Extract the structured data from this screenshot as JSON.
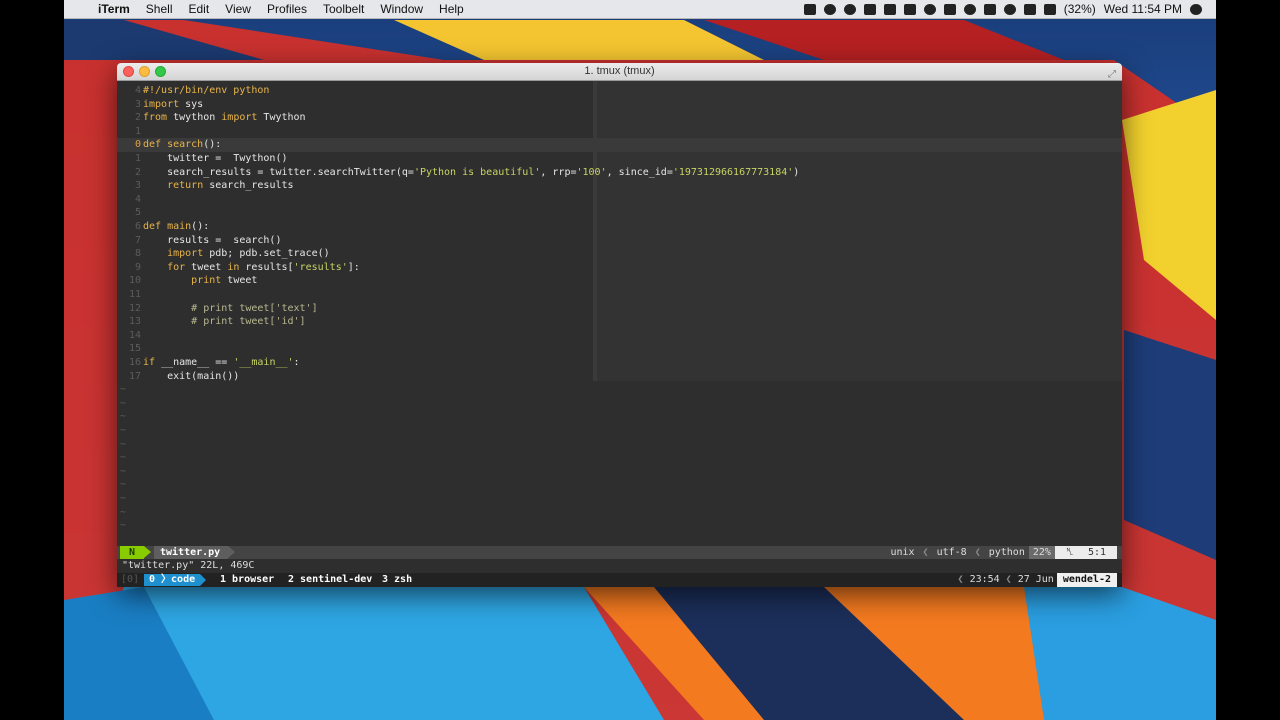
{
  "menubar": {
    "app_name": "iTerm",
    "items": [
      "Shell",
      "Edit",
      "View",
      "Profiles",
      "Toolbelt",
      "Window",
      "Help"
    ],
    "battery": "(32%)",
    "clock": "Wed 11:54 PM"
  },
  "window": {
    "title": "1. tmux (tmux)"
  },
  "editor": {
    "lines": [
      {
        "n": "4",
        "tokens": [
          {
            "t": "#!/usr/bin/env python",
            "c": "kw"
          }
        ]
      },
      {
        "n": "3",
        "tokens": [
          {
            "t": "import",
            "c": "kw"
          },
          {
            "t": " sys",
            "c": "pl"
          }
        ]
      },
      {
        "n": "2",
        "tokens": [
          {
            "t": "from",
            "c": "kw"
          },
          {
            "t": " twython ",
            "c": "pl"
          },
          {
            "t": "import",
            "c": "kw"
          },
          {
            "t": " Twython",
            "c": "pl"
          }
        ]
      },
      {
        "n": "1",
        "tokens": []
      },
      {
        "n": "0",
        "cur": true,
        "tokens": [
          {
            "t": "def",
            "c": "kw"
          },
          {
            "t": " search",
            "c": "sb"
          },
          {
            "t": "():",
            "c": "pl"
          }
        ]
      },
      {
        "n": "1",
        "tokens": [
          {
            "t": "    twitter =  Twython()",
            "c": "pl"
          }
        ]
      },
      {
        "n": "2",
        "tokens": [
          {
            "t": "    search_results = twitter.searchTwitter(q=",
            "c": "pl"
          },
          {
            "t": "'Python is beautiful'",
            "c": "str"
          },
          {
            "t": ", rrp=",
            "c": "pl"
          },
          {
            "t": "'100'",
            "c": "str"
          },
          {
            "t": ", since_id=",
            "c": "pl"
          },
          {
            "t": "'197312966167773184'",
            "c": "str"
          },
          {
            "t": ")",
            "c": "pl"
          }
        ]
      },
      {
        "n": "3",
        "tokens": [
          {
            "t": "    ",
            "c": "pl"
          },
          {
            "t": "return",
            "c": "kw"
          },
          {
            "t": " search_results",
            "c": "pl"
          }
        ]
      },
      {
        "n": "4",
        "tokens": []
      },
      {
        "n": "5",
        "tokens": []
      },
      {
        "n": "6",
        "tokens": [
          {
            "t": "def",
            "c": "kw"
          },
          {
            "t": " main",
            "c": "sb"
          },
          {
            "t": "():",
            "c": "pl"
          }
        ]
      },
      {
        "n": "7",
        "tokens": [
          {
            "t": "    results =  search()",
            "c": "pl"
          }
        ]
      },
      {
        "n": "8",
        "tokens": [
          {
            "t": "    ",
            "c": "pl"
          },
          {
            "t": "import",
            "c": "kw"
          },
          {
            "t": " pdb; pdb.set_trace()",
            "c": "pl"
          }
        ]
      },
      {
        "n": "9",
        "tokens": [
          {
            "t": "    ",
            "c": "pl"
          },
          {
            "t": "for",
            "c": "kw"
          },
          {
            "t": " tweet ",
            "c": "pl"
          },
          {
            "t": "in",
            "c": "kw"
          },
          {
            "t": " results[",
            "c": "pl"
          },
          {
            "t": "'results'",
            "c": "str"
          },
          {
            "t": "]:",
            "c": "pl"
          }
        ]
      },
      {
        "n": "10",
        "tokens": [
          {
            "t": "        ",
            "c": "pl"
          },
          {
            "t": "print",
            "c": "kw"
          },
          {
            "t": " tweet",
            "c": "pl"
          }
        ]
      },
      {
        "n": "11",
        "tokens": []
      },
      {
        "n": "12",
        "tokens": [
          {
            "t": "        # print tweet['text']",
            "c": "cm"
          }
        ]
      },
      {
        "n": "13",
        "tokens": [
          {
            "t": "        # print tweet['id']",
            "c": "cm"
          }
        ]
      },
      {
        "n": "14",
        "tokens": []
      },
      {
        "n": "15",
        "tokens": []
      },
      {
        "n": "16",
        "tokens": [
          {
            "t": "if",
            "c": "kw"
          },
          {
            "t": " __name__ == ",
            "c": "pl"
          },
          {
            "t": "'__main__'",
            "c": "str"
          },
          {
            "t": ":",
            "c": "pl"
          }
        ]
      },
      {
        "n": "17",
        "tokens": [
          {
            "t": "    exit(main())",
            "c": "pl"
          }
        ]
      }
    ],
    "tilde_count": 11,
    "tilde_char": "~"
  },
  "statusline": {
    "mode": "N",
    "filename": "twitter.py",
    "fileformat": "unix",
    "encoding": "utf-8",
    "filetype": "python",
    "percent": "22%",
    "position": "5:1",
    "line_symbol": "␤"
  },
  "message": "\"twitter.py\" 22L, 469C",
  "tmux": {
    "session": "[0]",
    "active_window": "0 〉code",
    "windows": [
      "1 browser",
      "2 sentinel-dev",
      "3 zsh"
    ],
    "time": "23:54",
    "date": "27 Jun",
    "host": "wendel-2"
  },
  "colors": {
    "terminal_bg": "#2e2e2e",
    "mode_green": "#88cc00",
    "tmux_active_blue": "#1e90d0",
    "keyword": "#e8b44a",
    "string": "#c8d464"
  }
}
